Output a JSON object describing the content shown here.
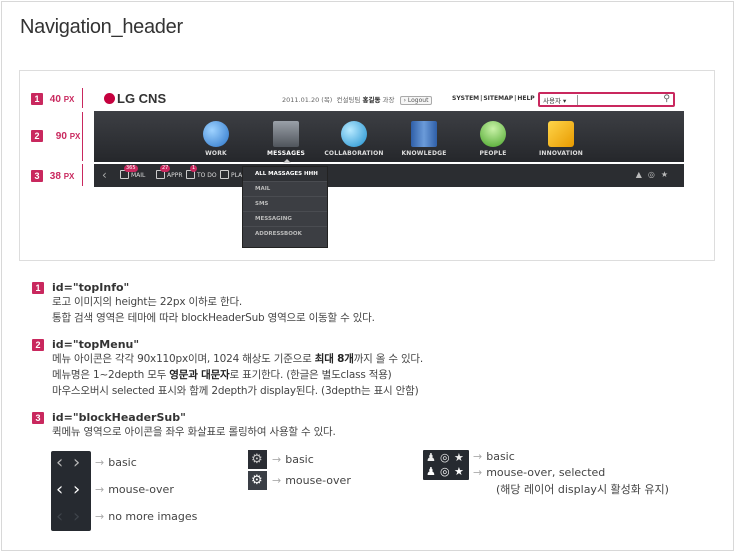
{
  "page": {
    "title": "Navigation_header"
  },
  "preview": {
    "dimension_labels": [
      {
        "num": "1",
        "value": "40",
        "unit": "PX"
      },
      {
        "num": "2",
        "value": "90",
        "unit": "PX"
      },
      {
        "num": "3",
        "value": "38",
        "unit": "PX"
      }
    ],
    "top_info": {
      "logo_text": "LG CNS",
      "date": "2011.01.20 (목)",
      "dept": "컨설팅팀",
      "user_name": "홍길동",
      "user_title": "과장",
      "logout_label": "Logout",
      "links": [
        "SYSTEM",
        "SITEMAP",
        "HELP"
      ],
      "search_select": "사용자"
    },
    "menu": [
      {
        "label": "WORK",
        "color": "#3b86d6"
      },
      {
        "label": "MESSAGES",
        "color": "#6f747c"
      },
      {
        "label": "COLLABORATION",
        "color": "#2e9fd9"
      },
      {
        "label": "KNOWLEDGE",
        "color": "#4d7fc2"
      },
      {
        "label": "PEOPLE",
        "color": "#5cb83a"
      },
      {
        "label": "INNOVATION",
        "color": "#f0a800"
      }
    ],
    "dropdown": [
      "ALL MASSAGES HHH",
      "MAIL",
      "SMS",
      "MESSAGING",
      "ADDRESSBOOK"
    ],
    "sub_items": [
      {
        "label": "MAIL",
        "badge": "365"
      },
      {
        "label": "APPR",
        "badge": "27"
      },
      {
        "label": "TO DO",
        "badge": "1"
      },
      {
        "label": "PLA",
        "badge": ""
      }
    ]
  },
  "sections": [
    {
      "num": "1",
      "heading": "id=\"topInfo\"",
      "lines": [
        "로고 이미지의 height는 22px 이하로 한다.",
        "통합 검색 영역은 테마에 따라 blockHeaderSub 영역으로 이동할 수 있다."
      ]
    },
    {
      "num": "2",
      "heading": "id=\"topMenu\"",
      "lines": [
        "메뉴 아이콘은 각각 90x110px이며, 1024 해상도 기준으로 ",
        "메뉴명은 1~2depth 모두 ",
        "마우스오버시 selected 표시와 함께 2depth가 display된다. (3depth는 표시 안함)"
      ],
      "line1_bold": "최대 8개",
      "line1_tail": "까지 올 수 있다.",
      "line2_bold": "영문과 대문자",
      "line2_tail": "로 표기한다. (한글은 별도class 적용)"
    },
    {
      "num": "3",
      "heading": "id=\"blockHeaderSub\"",
      "lines": [
        "퀵메뉴 영역으로 아이콘을 좌우 화살표로 롤링하여 사용할 수 있다."
      ]
    }
  ],
  "demo": {
    "arrow": "→",
    "arrows_states": [
      "basic",
      "mouse-over",
      "no more images"
    ],
    "gear_states": [
      "basic",
      "mouse-over"
    ],
    "right_states": [
      "basic",
      "mouse-over, selected",
      "(해당 레이어 display시 활성화 유지)"
    ]
  }
}
